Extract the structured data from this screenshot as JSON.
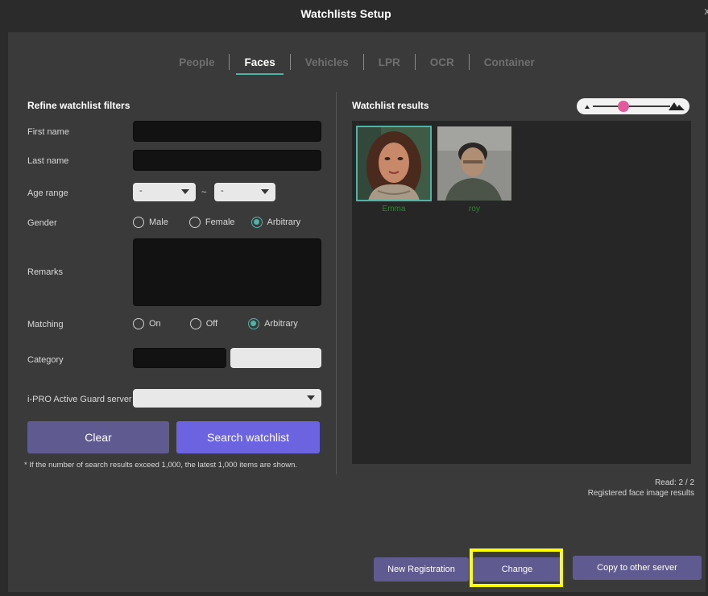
{
  "window": {
    "title": "Watchlists Setup",
    "close_glyph": "x"
  },
  "tabs": [
    {
      "label": "People",
      "active": false
    },
    {
      "label": "Faces",
      "active": true
    },
    {
      "label": "Vehicles",
      "active": false
    },
    {
      "label": "LPR",
      "active": false
    },
    {
      "label": "OCR",
      "active": false
    },
    {
      "label": "Container",
      "active": false
    }
  ],
  "filters": {
    "title": "Refine watchlist filters",
    "first_name": {
      "label": "First name",
      "value": ""
    },
    "last_name": {
      "label": "Last name",
      "value": ""
    },
    "age_range": {
      "label": "Age range",
      "from": "-",
      "separator": "~",
      "to": "-"
    },
    "gender": {
      "label": "Gender",
      "options": [
        "Male",
        "Female",
        "Arbitrary"
      ],
      "selected": "Arbitrary"
    },
    "remarks": {
      "label": "Remarks",
      "value": ""
    },
    "matching": {
      "label": "Matching",
      "options": [
        "On",
        "Off",
        "Arbitrary"
      ],
      "selected": "Arbitrary"
    },
    "category": {
      "label": "Category"
    },
    "server": {
      "label": "i-PRO Active Guard server",
      "value": ""
    },
    "clear_label": "Clear",
    "search_label": "Search watchlist",
    "note": "* If the number of search results exceed 1,000, the latest 1,000 items are shown."
  },
  "results": {
    "title": "Watchlist results",
    "items": [
      {
        "name": "Emma",
        "selected": true
      },
      {
        "name": "roy",
        "selected": false
      }
    ],
    "read": "Read: 2 / 2",
    "caption": "Registered face image results"
  },
  "footer": {
    "new_registration": "New Registration",
    "change": "Change",
    "copy": "Copy to other server"
  },
  "colors": {
    "accent": "#4fb3a6",
    "button": "#5f5a8f",
    "primary_button": "#6c63e0",
    "highlight": "#ffff00",
    "slider_knob": "#e05a9c"
  }
}
